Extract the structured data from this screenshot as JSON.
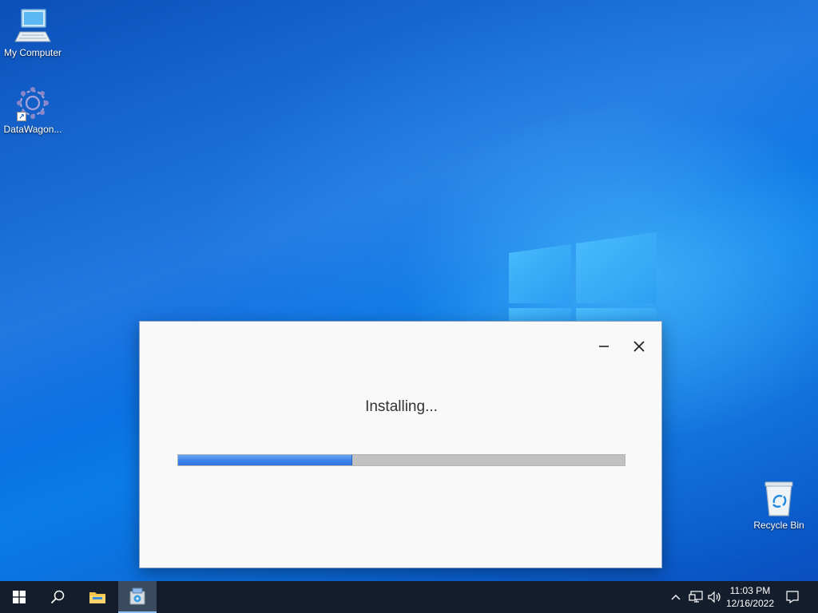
{
  "desktop": {
    "icons": [
      {
        "label": "My Computer",
        "icon": "computer-icon"
      },
      {
        "label": "DataWagon...",
        "icon": "datawagon-app-icon"
      },
      {
        "label": "Recycle Bin",
        "icon": "recycle-bin-icon"
      }
    ]
  },
  "dialog": {
    "status_text": "Installing...",
    "progress_percent": 39,
    "controls": {
      "minimize": "minimize-icon",
      "close": "close-icon"
    }
  },
  "taskbar": {
    "items": [
      "start-button",
      "search-icon",
      "file-explorer-icon",
      "installer-icon"
    ],
    "tray": [
      "chevron-up-icon",
      "network-icon",
      "volume-icon",
      "notification-icon"
    ],
    "clock_time": "11:03 PM",
    "clock_date": "12/16/2022"
  },
  "colors": {
    "wallpaper": "#0a6ae0",
    "progress_fill": "#3b82ea",
    "taskbar": "#141d2b"
  }
}
